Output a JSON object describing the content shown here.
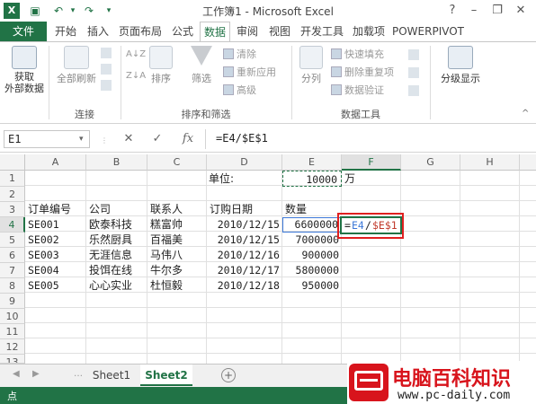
{
  "window": {
    "title": "工作簿1 - Microsoft Excel",
    "help": "?",
    "minimize": "–",
    "restore": "❐",
    "close": "✕"
  },
  "tabs": [
    "文件",
    "开始",
    "插入",
    "页面布局",
    "公式",
    "数据",
    "审阅",
    "视图",
    "开发工具",
    "加载项",
    "POWERPIVOT"
  ],
  "active_tab": "数据",
  "ribbon": {
    "get_external": "获取\n外部数据",
    "refresh_all": "全部刷新",
    "connections_group": "连接",
    "sort": "排序",
    "filter": "筛选",
    "clear": "清除",
    "reapply": "重新应用",
    "advanced": "高级",
    "sort_filter_group": "排序和筛选",
    "text_to_columns": "分列",
    "flash_fill": "快速填充",
    "remove_dupes": "删除重复项",
    "data_validation": "数据验证",
    "data_tools_group": "数据工具",
    "outline": "分级显示",
    "sort_az": "A↓Z",
    "sort_za": "Z↓A"
  },
  "formula_bar": {
    "name_box": "E1",
    "cancel": "✕",
    "enter": "✓",
    "fx": "fx",
    "formula": "=E4/$E$1"
  },
  "grid": {
    "columns": [
      "A",
      "B",
      "C",
      "D",
      "E",
      "F",
      "G",
      "H"
    ],
    "rows": [
      "1",
      "2",
      "3",
      "4",
      "5",
      "6",
      "7",
      "8",
      "9",
      "10",
      "11",
      "12",
      "13"
    ],
    "unit_label": "单位:",
    "unit_value": "10000",
    "unit_suffix": "万",
    "headers": [
      "订单编号",
      "公司",
      "联系人",
      "订购日期",
      "数量"
    ],
    "data": [
      [
        "SE001",
        "欧泰科技",
        "糕富帅",
        "2010/12/15",
        "6600000"
      ],
      [
        "SE002",
        "乐然厨具",
        "百福美",
        "2010/12/15",
        "7000000"
      ],
      [
        "SE003",
        "无涯信息",
        "马伟八",
        "2010/12/16",
        "900000"
      ],
      [
        "SE004",
        "投饵在线",
        "牛尔多",
        "2010/12/17",
        "5800000"
      ],
      [
        "SE005",
        "心心实业",
        "杜恒毅",
        "2010/12/18",
        "950000"
      ]
    ],
    "edit_eq": "=",
    "edit_ref1": "E4",
    "edit_slash": "/",
    "edit_ref2": "$E$1"
  },
  "sheets": [
    "Sheet1",
    "Sheet2"
  ],
  "active_sheet": "Sheet2",
  "add_sheet": "+",
  "status": "点",
  "watermark": {
    "title": "电脑百科知识",
    "url": "www.pc-daily.com"
  },
  "colors": {
    "excel_green": "#217346",
    "ref_blue": "#3c78d8",
    "ref_red": "#c0392b",
    "highlight_box": "#e02020"
  }
}
